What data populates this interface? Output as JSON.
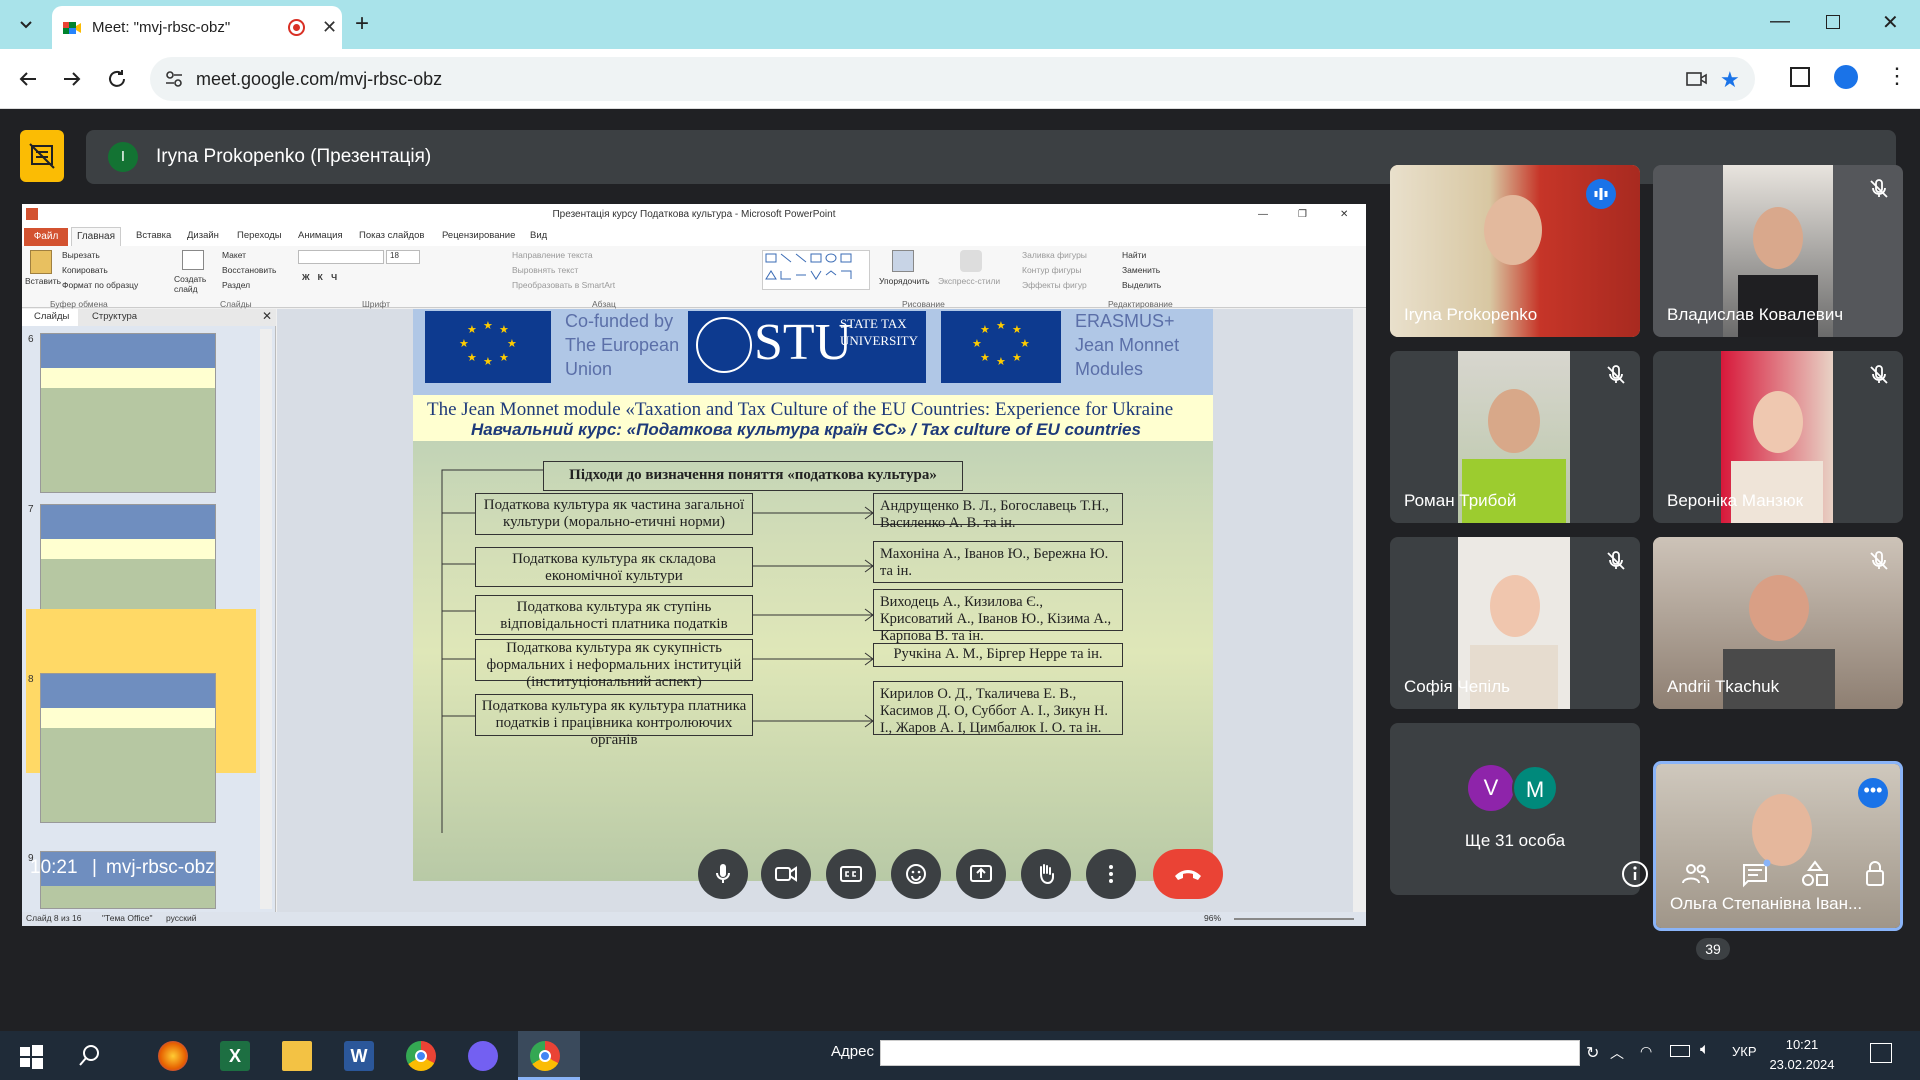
{
  "browser": {
    "tab_title": "Meet: \"mvj-rbsc-obz\"",
    "url": "meet.google.com/mvj-rbsc-obz"
  },
  "meet": {
    "presenter_avatar_letter": "I",
    "presentation_label": "Iryna Prokopenko (Презентація)",
    "meeting_time": "10:21",
    "meeting_code": "mvj-rbsc-obz",
    "participant_count_badge": "39",
    "participants": [
      {
        "name": "Iryna Prokopenko",
        "status": "speaking"
      },
      {
        "name": "Владислав Ковалевич",
        "status": "muted"
      },
      {
        "name": "Роман Трибой",
        "status": "muted"
      },
      {
        "name": "Вероніка Манзюк",
        "status": "muted"
      },
      {
        "name": "Софія Чепіль",
        "status": "muted"
      },
      {
        "name": "Andrii Tkachuk",
        "status": "muted"
      },
      {
        "name": "Ще 31 особа",
        "avatars": [
          "V",
          "M"
        ]
      },
      {
        "name": "Ольга Степанівна Іван...",
        "status": "self"
      }
    ],
    "colors": {
      "hangup": "#ea4335",
      "background": "#202124",
      "tile": "#3c4043",
      "accent": "#8ab4f8"
    }
  },
  "powerpoint": {
    "window_title": "Презентація курсу Податкова культура - Microsoft PowerPoint",
    "ribbon_tabs": [
      "Файл",
      "Главная",
      "Вставка",
      "Дизайн",
      "Переходы",
      "Анимация",
      "Показ слайдов",
      "Рецензирование",
      "Вид"
    ],
    "clipboard": {
      "paste": "Вставить",
      "cut": "Вырезать",
      "copy": "Копировать",
      "format": "Формат по образцу",
      "group": "Буфер обмена"
    },
    "slides_group": {
      "create": "Создать слайд",
      "layout": "Макет",
      "reset": "Восстановить",
      "section": "Раздел",
      "group": "Слайды"
    },
    "font_group": "Шрифт",
    "font_size": "18",
    "paragraph_group": "Абзац",
    "paragraph_items": [
      "Направление текста",
      "Выровнять текст",
      "Преобразовать в SmartArt"
    ],
    "drawing_group": "Рисование",
    "drawing_items": [
      "Упорядочить",
      "Экспресс-стили",
      "Заливка фигуры",
      "Контур фигуры",
      "Эффекты фигур"
    ],
    "editing_group": "Редактирование",
    "editing_items": [
      "Найти",
      "Заменить",
      "Выделить"
    ],
    "pane_tabs": [
      "Слайды",
      "Структура"
    ],
    "thumb_numbers": [
      "6",
      "7",
      "8",
      "9"
    ],
    "status": {
      "slide": "Слайд 8 из 16",
      "theme": "\"Тема Office\"",
      "lang": "русский",
      "zoom": "96%"
    }
  },
  "slide": {
    "cofunded": "Co-funded by The European Union",
    "stu_big": "STU",
    "stu_small": "STATE TAX UNIVERSITY",
    "erasmus": "ERASMUS+ Jean Monnet Modules",
    "module_line": "The Jean Monnet module «Taxation and Tax Culture of the EU Countries: Experience for Ukraine",
    "course_line": "Навчальний курс: «Податкова культура країн ЄС» / Tax culture of EU countries",
    "diagram_title": "Підходи до визначення поняття «податкова культура»",
    "rows": [
      {
        "approach": "Податкова культура як частина загальної культури (морально-етичні норми)",
        "authors": "Андрущенко В. Л., Богославець Т.Н., Василенко А. В. та ін."
      },
      {
        "approach": "Податкова культура як складова економічної культури",
        "authors": "Махоніна А., Іванов Ю., Бережна Ю. та ін."
      },
      {
        "approach": "Податкова культура як ступінь відповідальності платника податків",
        "authors": "Виходець А., Кизилова Є., Крисоватий А., Іванов Ю., Кізима А., Карпова В. та ін."
      },
      {
        "approach": "Податкова культура як сукупність формальних і неформальних інституцій (інституціональний аспект)",
        "authors": "Ручкіна А. М., Біргер Нерре та ін."
      },
      {
        "approach": "Податкова культура як культура платника податків і працівника контролюючих органів",
        "authors": "Кирилов О. Д., Ткаличева Е. В., Касимов Д. О, Суббот А. І., Зикун Н. І., Жаров А. І, Цимбалюк І. О. та ін."
      }
    ]
  },
  "taskbar": {
    "address_label": "Адрес",
    "language": "УКР",
    "time": "10:21",
    "date": "23.02.2024"
  }
}
